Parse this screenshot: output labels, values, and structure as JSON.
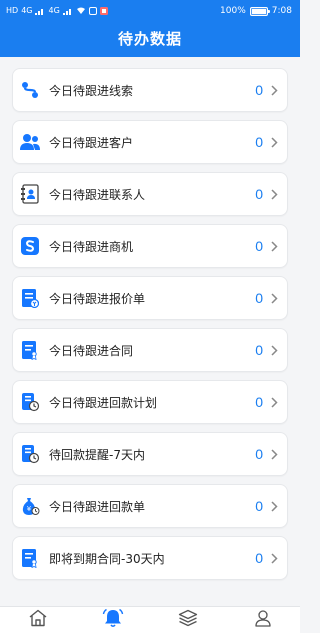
{
  "status_bar": {
    "left_indicators": [
      "HD",
      "4G",
      "4G"
    ],
    "battery": "100%",
    "time": "7:08"
  },
  "header": {
    "title": "待办数据"
  },
  "items": [
    {
      "label": "今日待跟进线索",
      "count": "0",
      "icon": "link-icon"
    },
    {
      "label": "今日待跟进客户",
      "count": "0",
      "icon": "customers-icon"
    },
    {
      "label": "今日待跟进联系人",
      "count": "0",
      "icon": "contact-book-icon"
    },
    {
      "label": "今日待跟进商机",
      "count": "0",
      "icon": "opportunity-icon"
    },
    {
      "label": "今日待跟进报价单",
      "count": "0",
      "icon": "quote-icon"
    },
    {
      "label": "今日待跟进合同",
      "count": "0",
      "icon": "contract-icon"
    },
    {
      "label": "今日待跟进回款计划",
      "count": "0",
      "icon": "payment-plan-icon"
    },
    {
      "label": "待回款提醒-7天内",
      "count": "0",
      "icon": "payment-reminder-icon"
    },
    {
      "label": "今日待跟进回款单",
      "count": "0",
      "icon": "payment-bag-icon"
    },
    {
      "label": "即将到期合同-30天内",
      "count": "0",
      "icon": "expiring-contract-icon"
    }
  ],
  "tabs": [
    {
      "icon": "home-icon",
      "active": false
    },
    {
      "icon": "bell-icon",
      "active": true
    },
    {
      "icon": "layers-icon",
      "active": false
    },
    {
      "icon": "user-icon",
      "active": false
    }
  ],
  "colors": {
    "primary": "#1a7ef0",
    "icon_blue": "#1677ff",
    "tab_inactive": "#555555"
  }
}
